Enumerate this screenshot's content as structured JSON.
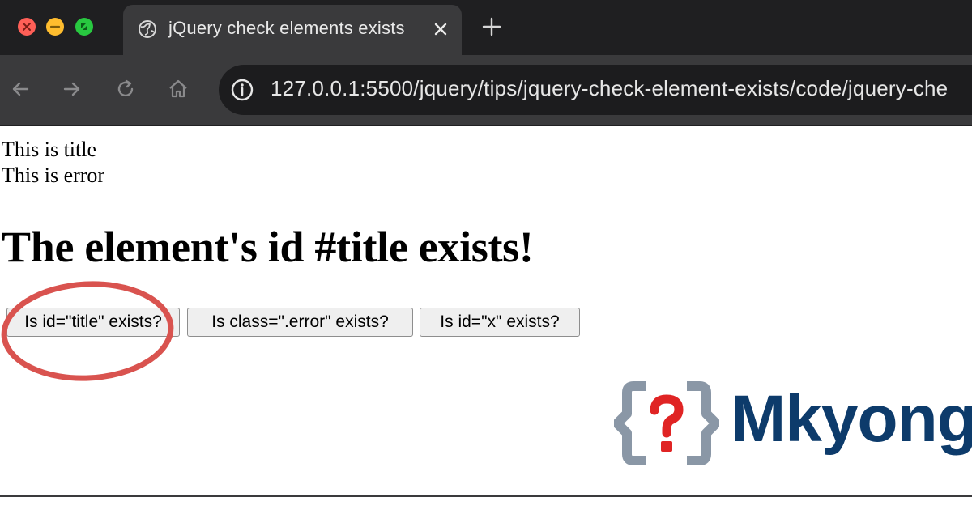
{
  "browser": {
    "tab_title": "jQuery check elements exists",
    "url": "127.0.0.1:5500/jquery/tips/jquery-check-element-exists/code/jquery-che"
  },
  "icons": {
    "tab": "globe-icon",
    "tab_close": "close-icon",
    "new_tab": "plus-icon",
    "back": "arrow-left-icon",
    "forward": "arrow-right-icon",
    "reload": "reload-icon",
    "home": "home-icon",
    "site_info": "info-icon"
  },
  "page": {
    "line1": "This is title",
    "line2": "This is error",
    "heading": "The element's id #title exists!",
    "buttons": [
      {
        "label": "Is id=\"title\" exists?"
      },
      {
        "label": "Is class=\".error\" exists?"
      },
      {
        "label": "Is id=\"x\" exists?"
      }
    ]
  },
  "watermark": {
    "brand": "Mkyong."
  },
  "colors": {
    "annotation_circle": "#d9534f",
    "brand_blue": "#0d3b6b",
    "logo_red": "#e02424",
    "logo_gray": "#8a97a6"
  }
}
